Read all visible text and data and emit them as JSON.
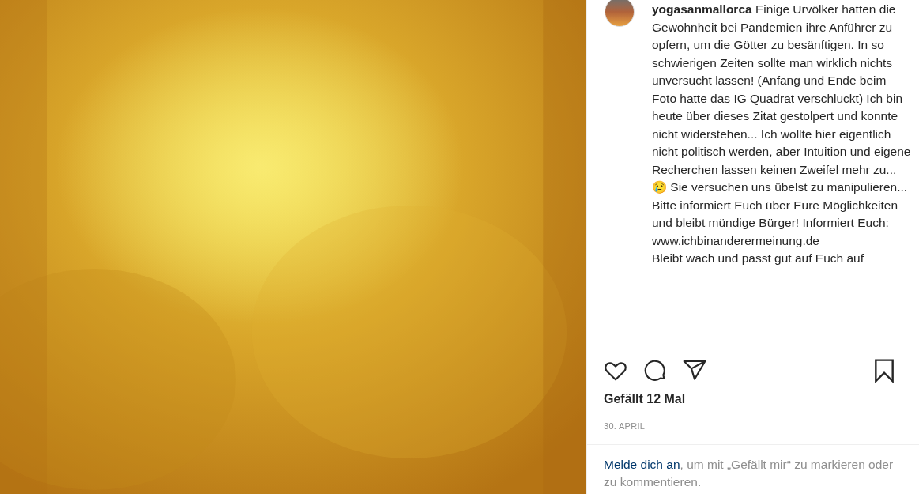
{
  "post": {
    "caption": "**yogasanmallorca** Einige Urvölker hatten die Gewohnheit bei Pandemien ihre Anführer zu opfern, um die Götter zu besänftigen. In so schwierigen Zeiten sollte man wirklich nichts unversucht lassen! (Anfang und Ende beim Foto hatte das IG Quadrat verschluckt) Ich bin heute über dieses Zitat gestolpert und konnte nicht widerstehen... Ich wollte hier eigentlich nicht politisch werden, aber Intuition und eigene Recherchen lassen keinen Zweifel mehr zu... 😢 Sie versuchen uns übelst zu manipulieren... Bitte informiert Euch über Eure Möglichkeiten und bleibt mündige Bürger! Informiert Euch: www.ichbinanderermeinung.de",
    "caption_end": "Bleibt wach und passt gut auf Euch auf",
    "liked": false,
    "saved": false,
    "likes": "Gefällt 12 Mal",
    "date": "30. APRIL",
    "login_link": "Melde dich an",
    "login_text": ", um mit „Gefällt mir“ zu markieren oder zu kommentieren."
  }
}
